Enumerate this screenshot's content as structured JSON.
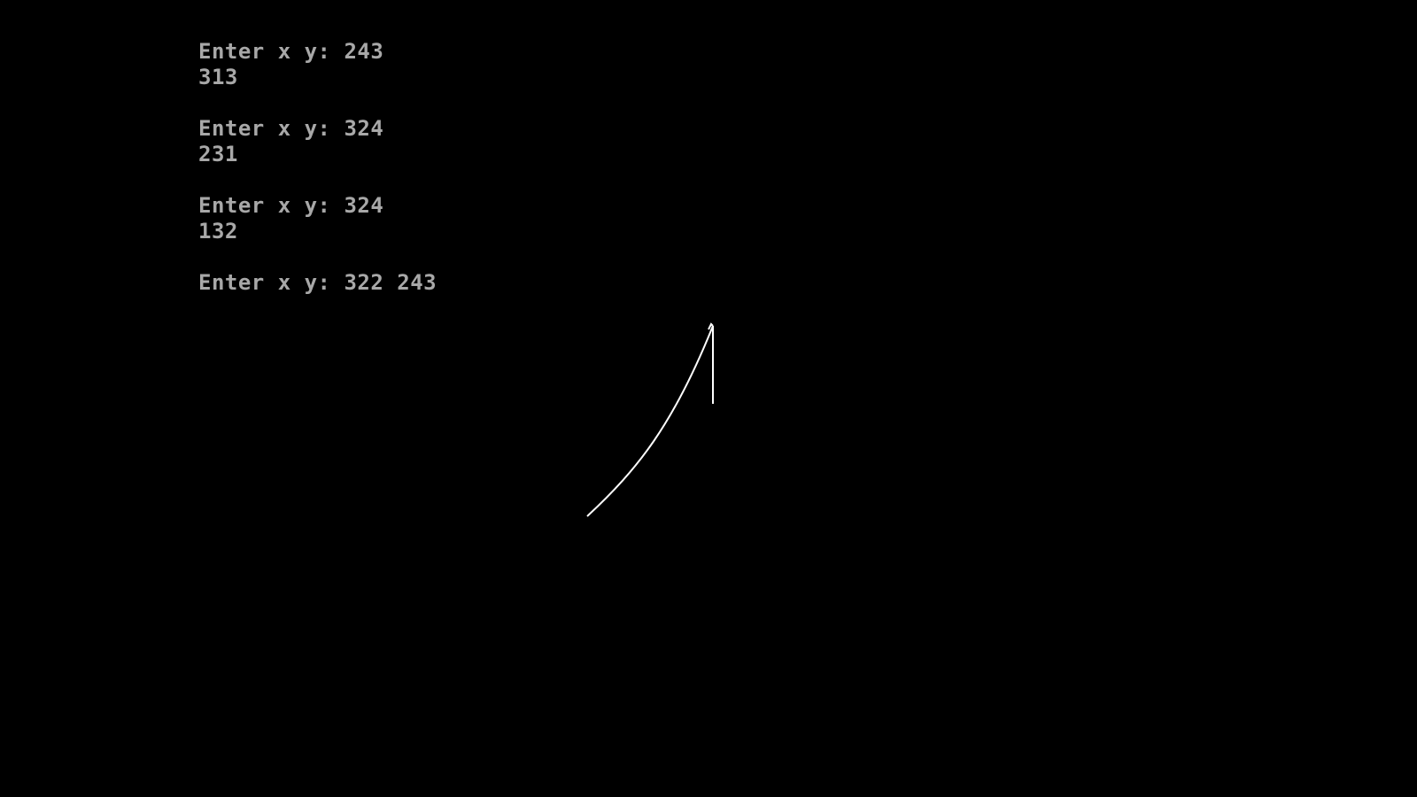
{
  "console": {
    "lines": [
      "Enter x y: 243",
      "313",
      "",
      "Enter x y: 324",
      "231",
      "",
      "Enter x y: 324",
      "132",
      "",
      "Enter x y: 322 243"
    ]
  },
  "colors": {
    "background": "#000000",
    "text": "#a8a8a8",
    "stroke": "#ffffff"
  }
}
